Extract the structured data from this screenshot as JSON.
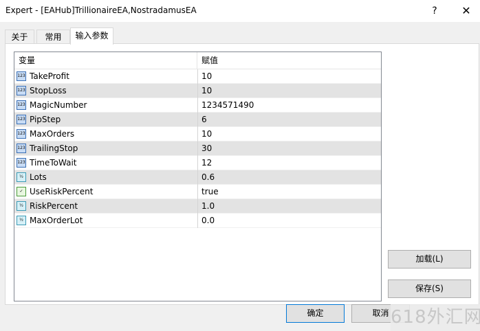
{
  "window": {
    "title": "Expert - [EAHub]TrillionaireEA,NostradamusEA",
    "help_glyph": "?",
    "close_glyph": "✕"
  },
  "tabs": [
    {
      "label": "关于",
      "active": false
    },
    {
      "label": "常用",
      "active": false
    },
    {
      "label": "输入参数",
      "active": true
    }
  ],
  "grid": {
    "columns": [
      "变量",
      "赋值"
    ],
    "rows": [
      {
        "name": "TakeProfit",
        "value": "10",
        "icon": "int-type-icon",
        "icon_text": "123"
      },
      {
        "name": "StopLoss",
        "value": "10",
        "icon": "int-type-icon",
        "icon_text": "123"
      },
      {
        "name": "MagicNumber",
        "value": "1234571490",
        "icon": "int-type-icon",
        "icon_text": "123"
      },
      {
        "name": "PipStep",
        "value": "6",
        "icon": "int-type-icon",
        "icon_text": "123"
      },
      {
        "name": "MaxOrders",
        "value": "10",
        "icon": "int-type-icon",
        "icon_text": "123"
      },
      {
        "name": "TrailingStop",
        "value": "30",
        "icon": "int-type-icon",
        "icon_text": "123"
      },
      {
        "name": "TimeToWait",
        "value": "12",
        "icon": "int-type-icon",
        "icon_text": "123"
      },
      {
        "name": "Lots",
        "value": "0.6",
        "icon": "double-type-icon",
        "icon_text": "½"
      },
      {
        "name": "UseRiskPercent",
        "value": "true",
        "icon": "bool-type-icon",
        "icon_text": "✓"
      },
      {
        "name": "RiskPercent",
        "value": "1.0",
        "icon": "double-type-icon",
        "icon_text": "½"
      },
      {
        "name": "MaxOrderLot",
        "value": "0.0",
        "icon": "double-type-icon",
        "icon_text": "½"
      }
    ]
  },
  "buttons": {
    "load": "加载(L)",
    "save": "保存(S)",
    "ok": "确定",
    "cancel": "取消"
  },
  "watermark": "618外汇网"
}
